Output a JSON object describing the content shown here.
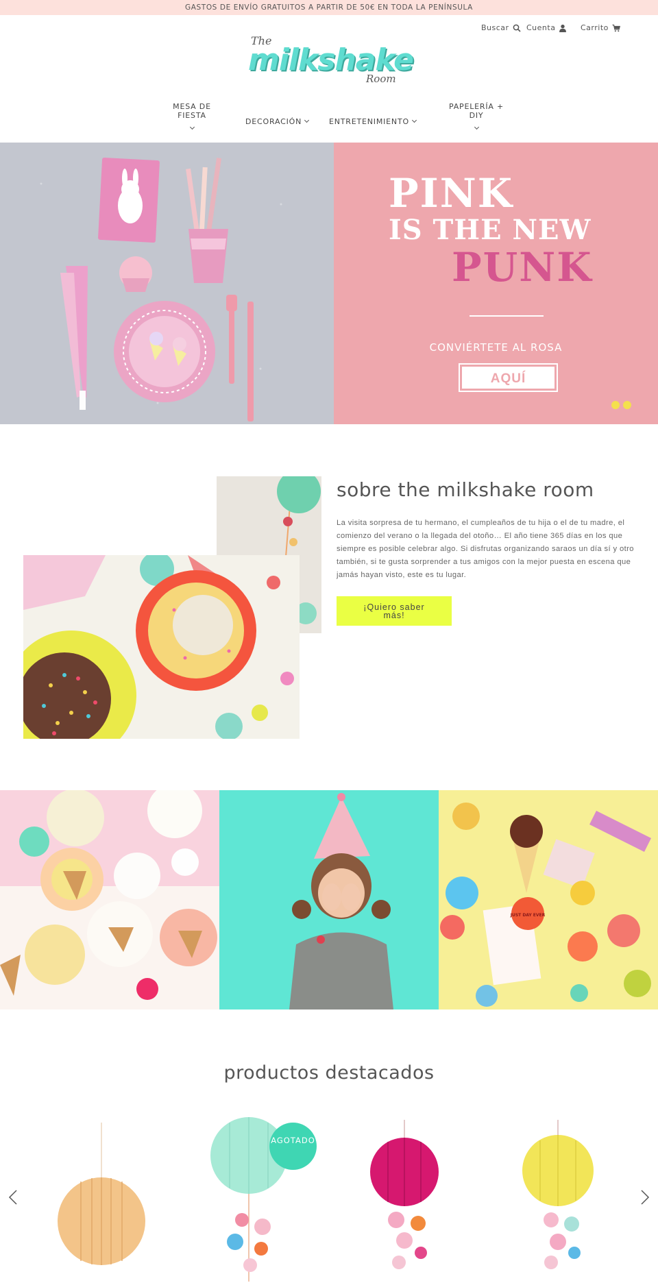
{
  "announcement": "GASTOS DE ENVÍO GRATUITOS A PARTIR DE 50€ EN TODA LA PENÍNSULA",
  "header": {
    "search_label": "Buscar",
    "account_label": "Cuenta",
    "cart_label": "Carrito",
    "logo": {
      "the": "The",
      "main": "milkshake",
      "room": "Room"
    }
  },
  "nav": [
    {
      "label": "MESA DE FIESTA"
    },
    {
      "label": "DECORACIÓN"
    },
    {
      "label": "ENTRETENIMIENTO"
    },
    {
      "label": "PAPELERÍA + DIY"
    }
  ],
  "hero": {
    "line1": "PINK",
    "line2": "IS THE NEW",
    "line3": "PUNK",
    "cta_text": "CONVIÉRTETE AL ROSA",
    "button_label": "AQUÍ",
    "slide_count": 2
  },
  "about": {
    "title": "sobre the milkshake room",
    "text": "La visita sorpresa de tu hermano, el cumpleaños de tu hija o el de tu madre, el comienzo del verano o la llegada del otoño… El año tiene 365 días en los que siempre es posible celebrar algo. Si disfrutas organizando saraos un día sí y otro también, si te gusta sorprender a tus amigos con la mejor puesta en escena que jamás hayan visto, este es tu lugar.",
    "button_label": "¡Quiero saber más!"
  },
  "tile_note": "JUST DAY EVER",
  "featured": {
    "title": "productos destacados",
    "sold_out_badge": "AGOTADO",
    "products": [
      {
        "color": "#f3c489"
      },
      {
        "color": "#a7ead6"
      },
      {
        "color": "#d6186f"
      },
      {
        "color": "#f2e558"
      }
    ]
  },
  "colors": {
    "announcement_bg": "#fde1dc",
    "logo_teal": "#5fdcd0",
    "hero_pink": "#eea7ad",
    "punk_pink": "#d5568f",
    "dot_yellow": "#f4e04d",
    "about_button": "#eaff44",
    "badge_green": "#3fd6b3"
  }
}
